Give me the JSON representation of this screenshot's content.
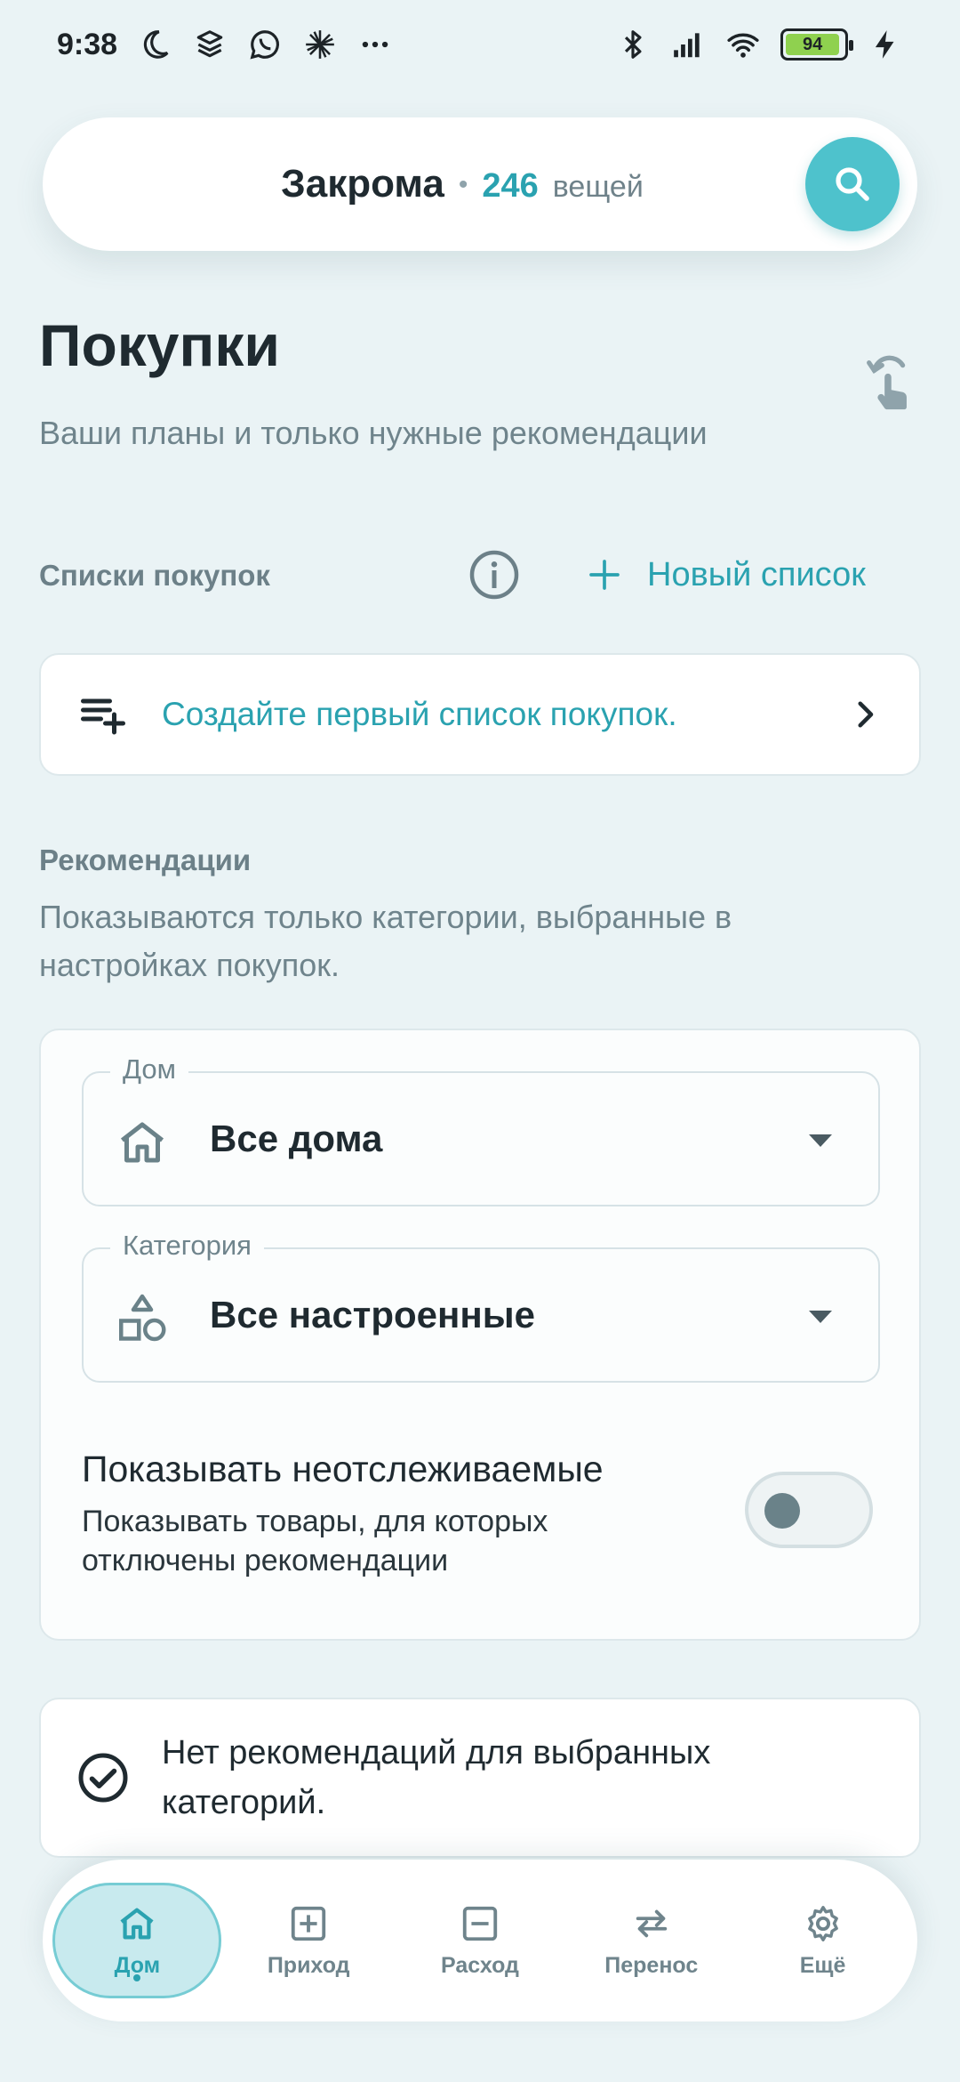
{
  "status_bar": {
    "time": "9:38",
    "battery": "94",
    "left_icons": [
      "moon-icon",
      "layers-icon",
      "whatsapp-icon",
      "burst-icon",
      "more-dots-icon"
    ],
    "right_icons": [
      "bluetooth-icon",
      "signal-icon",
      "wifi-icon",
      "battery-icon",
      "charging-icon"
    ]
  },
  "header": {
    "app_title": "Закрома",
    "separator": "•",
    "item_count": "246",
    "item_unit": "вещей",
    "search_icon": "search-icon"
  },
  "page": {
    "title": "Покупки",
    "subtitle": "Ваши планы и только нужные рекомендации"
  },
  "lists": {
    "section_label": "Списки покупок",
    "new_list_label": "Новый список",
    "create_first_text": "Создайте первый список покупок."
  },
  "recommendations": {
    "section_label": "Рекомендации",
    "description": "Показываются только категории, выбранные в настройках покупок.",
    "home_field": {
      "label": "Дом",
      "value": "Все дома"
    },
    "category_field": {
      "label": "Категория",
      "value": "Все настроенные"
    },
    "toggle": {
      "title": "Показывать неотслеживаемые",
      "description": "Показывать товары, для которых отключены рекомендации",
      "enabled": false
    },
    "empty_text": "Нет рекомендаций для выбранных категорий."
  },
  "bottom_nav": {
    "items": [
      {
        "label": "Дом",
        "icon": "home-icon",
        "active": true
      },
      {
        "label": "Приход",
        "icon": "plus-square-icon",
        "active": false
      },
      {
        "label": "Расход",
        "icon": "minus-square-icon",
        "active": false
      },
      {
        "label": "Перенос",
        "icon": "swap-arrows-icon",
        "active": false
      },
      {
        "label": "Ещё",
        "icon": "gear-icon",
        "active": false
      }
    ]
  },
  "colors": {
    "background": "#eaf3f5",
    "accent": "#2aa2b0",
    "search_button": "#4ec2cc",
    "muted_text": "#6f848c"
  }
}
